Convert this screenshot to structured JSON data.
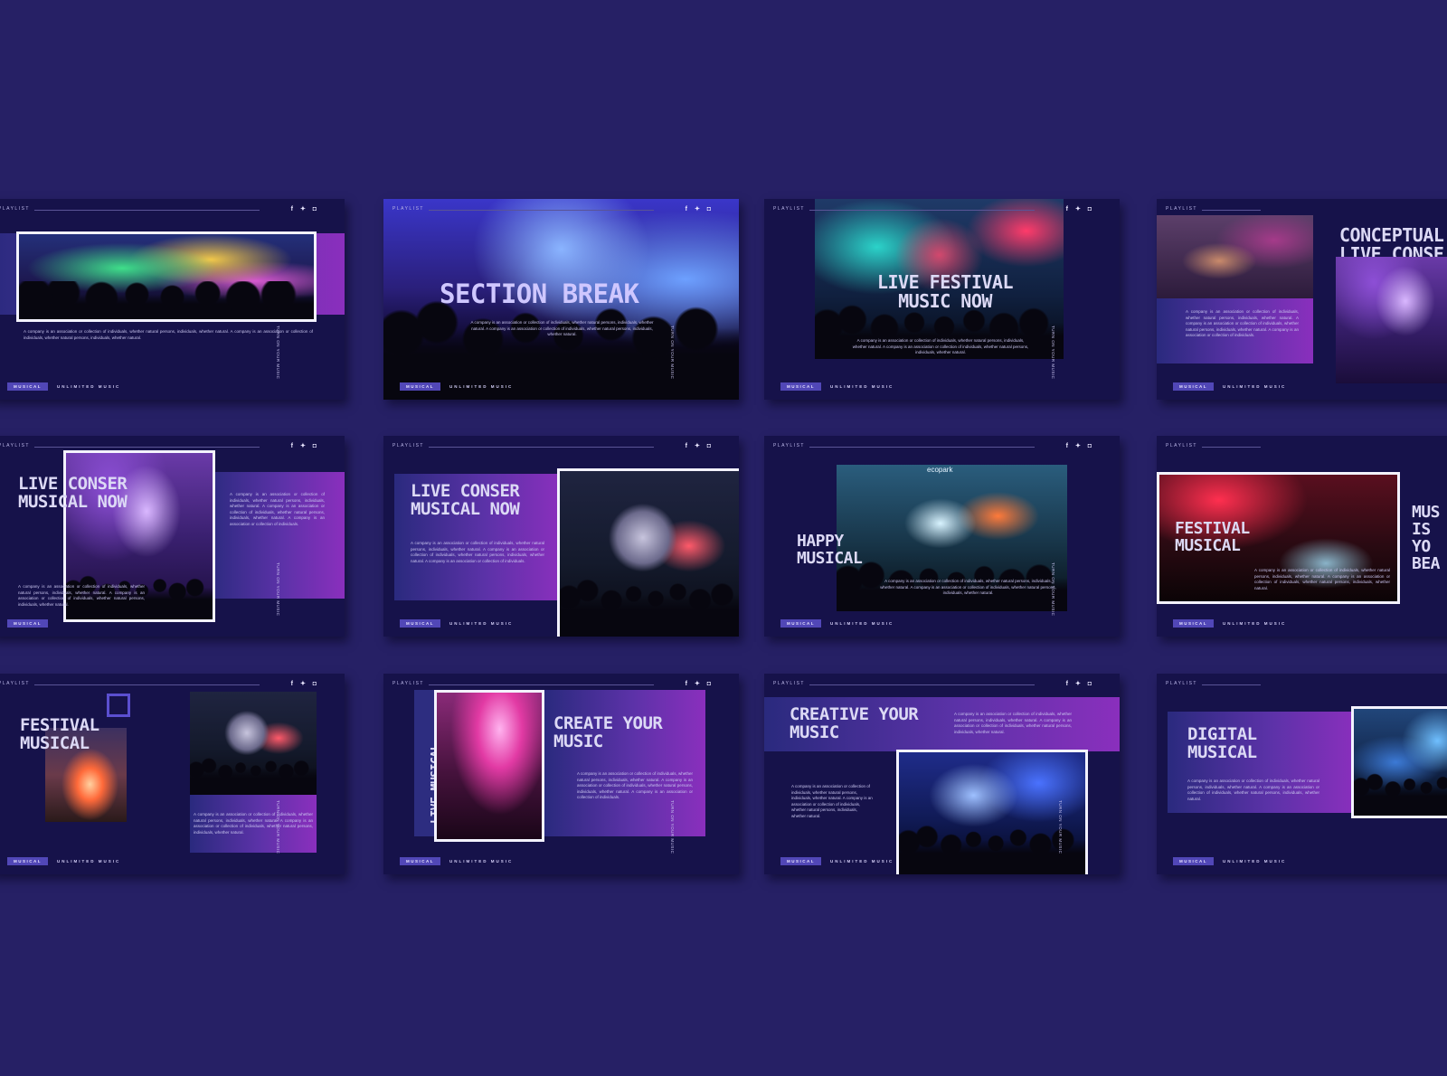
{
  "common": {
    "playlist": "PLAYLIST",
    "social": "f ✦ ◘",
    "tag": "MUSICAL",
    "unlimited": "UNLIMITED MUSIC",
    "vertical": "TURN ON YOUR MUSIC",
    "body_short": "A company is an association or collection of individuals, whether natural persons, individuals, whether natural. A company is an association or collection of individuals, whether natural persons, individuals, whether natural.",
    "body_long": "A company is an association or collection of individuals, whether natural persons, individuals, whether natural. A company is an association or collection of individuals, whether natural persons, individuals, whether natural. A company is an association or collection of individuals."
  },
  "slides": {
    "s2_title": "SECTION BREAK",
    "s3_title": "LIVE FESTIVAL MUSIC NOW",
    "s4_title": "CONCEPTUAL LIVE CONSE",
    "s5_title": "LIVE CONSER MUSICAL NOW",
    "s6_title": "LIVE CONSER MUSICAL NOW",
    "s7_title": "HAPPY MUSICAL",
    "s7_photo_text": "ecopark",
    "s8_title": "FESTIVAL MUSICAL",
    "s8_side": "MUS IS YO BEA",
    "s9_title": "FESTIVAL MUSICAL",
    "s10_vert": "LIVE MUSICAL",
    "s10_title": "CREATE YOUR MUSIC",
    "s11_title": "CREATIVE YOUR MUSIC",
    "s12_title": "DIGITAL MUSICAL"
  }
}
